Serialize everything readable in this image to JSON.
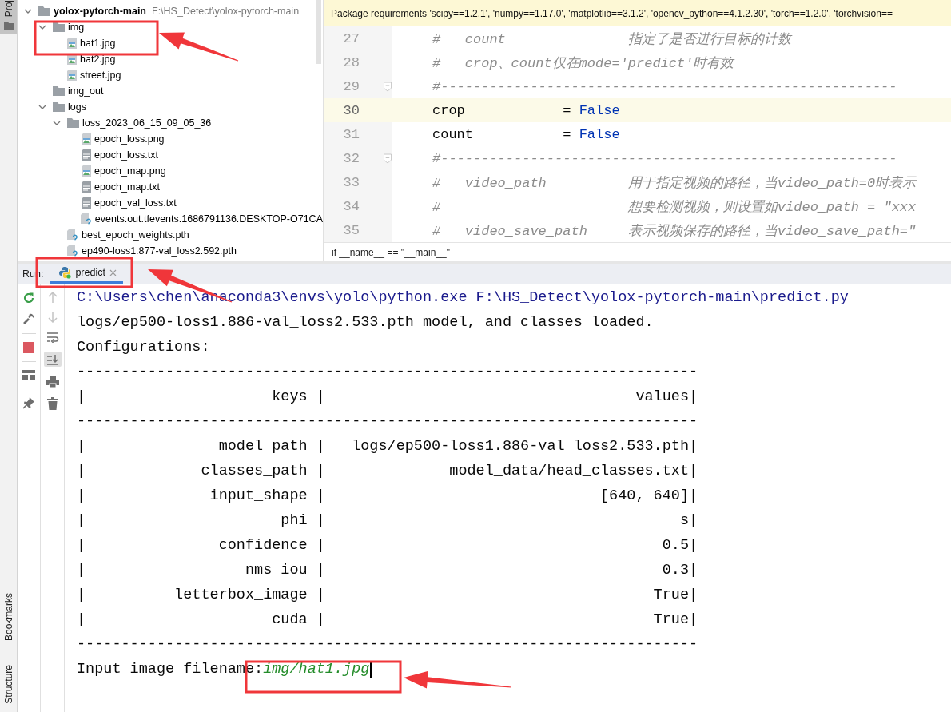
{
  "tool_strip": {
    "top": "Proj",
    "bottom": [
      "Bookmarks",
      "Structure"
    ]
  },
  "project_tree": [
    {
      "name": "yolox-pytorch-main",
      "path": "F:\\HS_Detect\\yolox-pytorch-main",
      "kind": "folder",
      "expanded": true,
      "children": [
        {
          "name": "img",
          "kind": "folder",
          "expanded": true,
          "children": [
            {
              "name": "hat1.jpg",
              "kind": "image"
            },
            {
              "name": "hat2.jpg",
              "kind": "image"
            },
            {
              "name": "street.jpg",
              "kind": "image"
            }
          ]
        },
        {
          "name": "img_out",
          "kind": "folder"
        },
        {
          "name": "logs",
          "kind": "folder",
          "expanded": true,
          "children": [
            {
              "name": "loss_2023_06_15_09_05_36",
              "kind": "folder",
              "expanded": true,
              "children": [
                {
                  "name": "epoch_loss.png",
                  "kind": "image"
                },
                {
                  "name": "epoch_loss.txt",
                  "kind": "text"
                },
                {
                  "name": "epoch_map.png",
                  "kind": "image"
                },
                {
                  "name": "epoch_map.txt",
                  "kind": "text"
                },
                {
                  "name": "epoch_val_loss.txt",
                  "kind": "text"
                },
                {
                  "name": "events.out.tfevents.1686791136.DESKTOP-O71CA",
                  "kind": "unknown"
                }
              ]
            },
            {
              "name": "best_epoch_weights.pth",
              "kind": "unknown"
            },
            {
              "name": "ep490-loss1.877-val_loss2.592.pth",
              "kind": "unknown"
            }
          ]
        }
      ]
    }
  ],
  "editor": {
    "notification": "Package requirements 'scipy==1.2.1', 'numpy==1.17.0', 'matplotlib==3.1.2', 'opencv_python==4.1.2.30', 'torch==1.2.0', 'torchvision==",
    "lines": [
      {
        "number": "27",
        "kind": "comment",
        "text": "#   count               指定了是否进行目标的计数",
        "current": false,
        "fold": false
      },
      {
        "number": "28",
        "kind": "comment",
        "text": "#   crop、count仅在mode='predict'时有效",
        "current": false,
        "fold": false
      },
      {
        "number": "29",
        "kind": "comment",
        "text": "#--------------------------------------------------------",
        "current": false,
        "fold": true
      },
      {
        "number": "30",
        "kind": "assign",
        "text": "crop            = ",
        "keyword": "False",
        "current": true,
        "fold": false
      },
      {
        "number": "31",
        "kind": "assign",
        "text": "count           = ",
        "keyword": "False",
        "current": false,
        "fold": false
      },
      {
        "number": "32",
        "kind": "comment",
        "text": "#--------------------------------------------------------",
        "current": false,
        "fold": true
      },
      {
        "number": "33",
        "kind": "comment",
        "text": "#   video_path          用于指定视频的路径，当video_path=0时表示",
        "current": false,
        "fold": false
      },
      {
        "number": "34",
        "kind": "comment",
        "text": "#                       想要检测视频，则设置如video_path = \"xxx",
        "current": false,
        "fold": false
      },
      {
        "number": "35",
        "kind": "comment",
        "text": "#   video_save_path     表示视频保存的路径，当video_save_path=\"",
        "current": false,
        "fold": false
      }
    ],
    "breadcrumb": "if __name__ == \"__main__\""
  },
  "run": {
    "label": "Run:",
    "tabs": [
      {
        "label": "predict",
        "selected": true
      }
    ],
    "console": [
      {
        "kind": "command",
        "text": "C:\\Users\\chen\\anaconda3\\envs\\yolo\\python.exe F:\\HS_Detect\\yolox-pytorch-main\\predict.py"
      },
      {
        "kind": "output",
        "text": "logs/ep500-loss1.886-val_loss2.533.pth model, and classes loaded."
      },
      {
        "kind": "output",
        "text": "Configurations:"
      },
      {
        "kind": "output",
        "text": "----------------------------------------------------------------------"
      },
      {
        "kind": "output",
        "text": "|                     keys |                                   values|"
      },
      {
        "kind": "output",
        "text": "----------------------------------------------------------------------"
      },
      {
        "kind": "output",
        "text": "|               model_path |   logs/ep500-loss1.886-val_loss2.533.pth|"
      },
      {
        "kind": "output",
        "text": "|             classes_path |              model_data/head_classes.txt|"
      },
      {
        "kind": "output",
        "text": "|              input_shape |                               [640, 640]|"
      },
      {
        "kind": "output",
        "text": "|                      phi |                                        s|"
      },
      {
        "kind": "output",
        "text": "|               confidence |                                      0.5|"
      },
      {
        "kind": "output",
        "text": "|                  nms_iou |                                      0.3|"
      },
      {
        "kind": "output",
        "text": "|          letterbox_image |                                     True|"
      },
      {
        "kind": "output",
        "text": "|                     cuda |                                     True|"
      },
      {
        "kind": "output",
        "text": "----------------------------------------------------------------------"
      },
      {
        "kind": "prompt",
        "text": "Input image filename:",
        "input": "img/hat1.jpg"
      }
    ]
  }
}
